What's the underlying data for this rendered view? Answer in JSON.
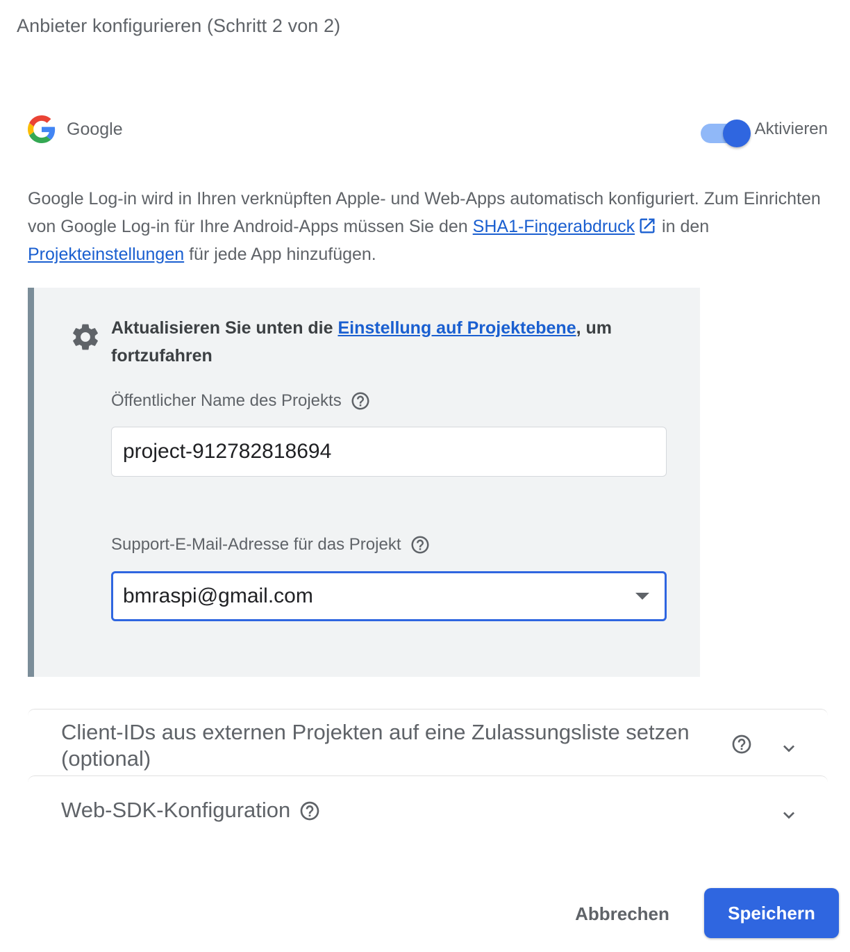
{
  "dialog": {
    "title": "Anbieter konfigurieren (Schritt  2 von 2)"
  },
  "provider": {
    "name": "Google",
    "logo_icon": "google-g-icon",
    "toggle_label": "Aktivieren",
    "enabled": true
  },
  "description": {
    "text_before": "Google Log-in wird in Ihren verknüpften Apple- und Web-Apps automatisch konfiguriert. Zum Einrichten von Google Log-in für Ihre Android-Apps müssen Sie den ",
    "sha1_link": "SHA1-Fingerabdruck",
    "text_middle": " in den ",
    "project_settings_link": "Projekteinstellungen",
    "text_after": " für jede App hinzufügen."
  },
  "settings_box": {
    "icon": "gear-icon",
    "text_before": "Aktualisieren Sie unten die ",
    "link": "Einstellung auf Projektebene",
    "text_after": ", um fortzufahren",
    "public_name_label": "Öffentlicher Name des Projekts",
    "public_name_value": "project-912782818694",
    "support_email_label": "Support-E-Mail-Adresse für das Projekt",
    "support_email_value": "bmraspi@gmail.com"
  },
  "expansions": [
    {
      "title": "Client-IDs aus externen Projekten auf eine Zulassungsliste setzen (optional)"
    },
    {
      "title": "Web-SDK-Konfiguration"
    }
  ],
  "actions": {
    "cancel_label": "Abbrechen",
    "save_label": "Speichern"
  },
  "colors": {
    "accent": "#2f66e0",
    "link": "#1a5fd0",
    "box_background": "#f1f3f4",
    "box_border": "#7b8d99"
  }
}
